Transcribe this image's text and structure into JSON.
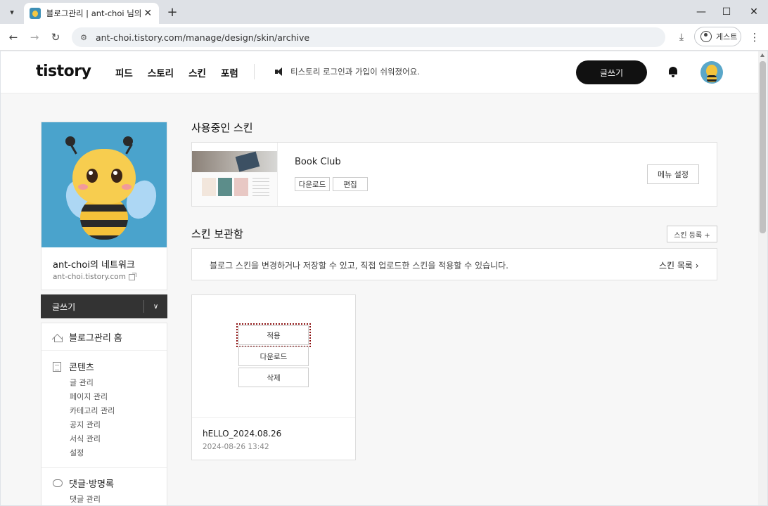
{
  "browser": {
    "tab_title": "블로그관리 | ant-choi 님의 블로그",
    "url": "ant-choi.tistory.com/manage/design/skin/archive",
    "profile_label": "게스트"
  },
  "header": {
    "logo": "tistory",
    "nav": [
      "피드",
      "스토리",
      "스킨",
      "포럼"
    ],
    "notice": "티스토리 로그인과 가입이 쉬워졌어요.",
    "write_label": "글쓰기"
  },
  "sidebar": {
    "blog_name": "ant-choi의 네트워크",
    "blog_url": "ant-choi.tistory.com",
    "write_label": "글쓰기",
    "home_label": "블로그관리 홈",
    "content_group": "콘텐츠",
    "content_items": [
      "글 관리",
      "페이지 관리",
      "카테고리 관리",
      "공지 관리",
      "서식 관리",
      "설정"
    ],
    "comment_group": "댓글·방명록",
    "comment_items": [
      "댓글 관리"
    ]
  },
  "main": {
    "current_skin_title": "사용중인 스킨",
    "current_skin": {
      "name": "Book Club",
      "download_label": "다운로드",
      "edit_label": "편집",
      "menu_setting_label": "메뉴 설정"
    },
    "archive_title": "스킨 보관함",
    "register_label": "스킨 등록 +",
    "info_text": "블로그 스킨을 변경하거나 저장할 수 있고, 직접 업로드한 스킨을 적용할 수 있습니다.",
    "skin_list_label": "스킨 목록 ›",
    "archive_card": {
      "apply_label": "적용",
      "download_label": "다운로드",
      "delete_label": "삭제",
      "name": "hELLO_2024.08.26",
      "date": "2024-08-26 13:42"
    }
  }
}
